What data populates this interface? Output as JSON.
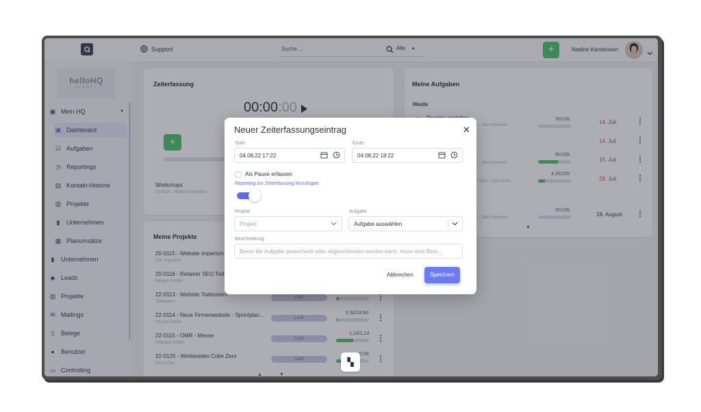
{
  "topbar": {
    "support_label": "Support",
    "search_placeholder": "Suche ...",
    "filter_value": "Alle",
    "user_name": "Nadine Karstensen"
  },
  "sidebar": {
    "logo_text": "helloHQ",
    "logo_sub": "AGENCY",
    "items": [
      {
        "label": "Mein HQ"
      },
      {
        "label": "Dashboard"
      },
      {
        "label": "Aufgaben"
      },
      {
        "label": "Reportings"
      },
      {
        "label": "Kontakt-Historie"
      },
      {
        "label": "Projekte"
      },
      {
        "label": "Unternehmen"
      },
      {
        "label": "Planumsätze"
      },
      {
        "label": "Unternehmen"
      },
      {
        "label": "Leads"
      },
      {
        "label": "Projekte"
      },
      {
        "label": "Mailings"
      },
      {
        "label": "Belege"
      },
      {
        "label": "Benutzer"
      },
      {
        "label": "Controlling"
      }
    ]
  },
  "zeiterfassung": {
    "title": "Zeiterfassung",
    "timer": "00:00",
    "timer_dim": ":00",
    "entry_title": "Workshops",
    "entry_sub": "20-0115 · Website Imperium"
  },
  "meine_projekte": {
    "title": "Meine Projekte",
    "rows": [
      {
        "title": "20-0115 - Website Imperium",
        "sub": "Das Imperium",
        "status": "",
        "hours": ""
      },
      {
        "title": "20-0116 - Retainer SEO Todo",
        "sub": "Morgen GmbH",
        "status": "",
        "hours": ""
      },
      {
        "title": "22-0113 - Website Todesstern",
        "sub": "Todesstern",
        "status": "Läuft",
        "hours": ""
      },
      {
        "title": "22-0114 - Neue Firmenwebsite - Sprintplan...",
        "sub": "HQ Act GmbH",
        "status": "Läuft",
        "hours": "0,3d/18,8d"
      },
      {
        "title": "22-0115 - OMR - Messe",
        "sub": "HQuality GmbH",
        "status": "Läuft",
        "hours": "1,1d/2,1d"
      },
      {
        "title": "22-0120 - Werbevideo Coke Zero",
        "sub": "Coca Cola",
        "status": "Läuft",
        "hours": "0,5d"
      }
    ]
  },
  "meine_aufgaben": {
    "title": "Meine Aufgaben",
    "section": "Heute",
    "rows": [
      {
        "title": "Designs erstellen",
        "meta": "20-0115 - Website Imperium · Das Imperium",
        "hours": "0h/10h",
        "progress": 0.0,
        "date": "14. Juli"
      },
      {
        "title": "",
        "meta": "",
        "hours": "",
        "progress": 0.0,
        "date": "14. Juli"
      },
      {
        "title": "",
        "meta": "20-0115 - Website Imperium · Das Imperium",
        "hours": "6h/10h",
        "progress": 0.6,
        "date": "15. Juli"
      },
      {
        "title": "",
        "meta": "22-0120 - Werbevideo Coke Zero · Coca Cola",
        "hours": "4,2h/20h",
        "progress": 0.21,
        "date": "29. Juli"
      },
      {
        "title": "",
        "meta": "20-0115 - Website Imperium · Das Imperium",
        "hours": "0h/10h",
        "progress": 0.0,
        "date": "18. August"
      }
    ]
  },
  "modal": {
    "title": "Neuer Zeiterfassungseintrag",
    "start_label": "Start",
    "start_value": "04.08.22 17:22",
    "end_label": "Ende",
    "end_value": "04.08.22 18:22",
    "pause_label": "Als Pause erfassen",
    "reporting_label": "Reporting zur Zeiterfassung hinzufügen",
    "reporting_on": true,
    "projekt_label": "Projekt",
    "projekt_placeholder": "Projekt",
    "aufgabe_label": "Aufgabe",
    "aufgabe_value": "Aufgabe auswählen",
    "beschreibung_label": "Beschreibung",
    "beschreibung_placeholder": "Bevor die Aufgabe gewechselt oder abgeschlossen werden kann, muss eine Besc...",
    "cancel_label": "Abbrechen",
    "save_label": "Speichern"
  },
  "colors": {
    "accent": "#5b6ee8",
    "green": "#4cc36b",
    "date_red": "#d23a50"
  }
}
